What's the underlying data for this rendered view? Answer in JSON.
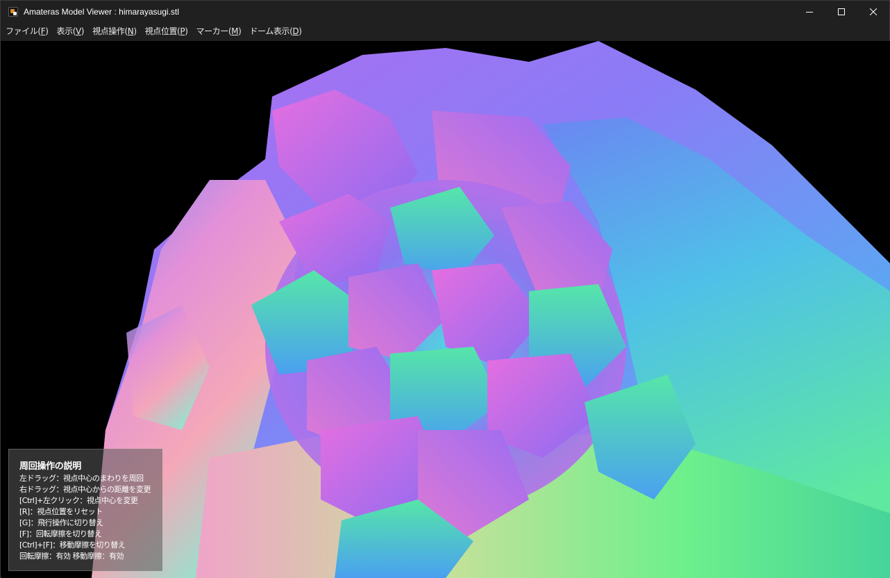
{
  "window": {
    "title": "Amateras Model Viewer : himarayasugi.stl"
  },
  "menu": [
    {
      "label": "ファイル(",
      "key": "F",
      "suffix": ")"
    },
    {
      "label": "表示(",
      "key": "V",
      "suffix": ")"
    },
    {
      "label": "視点操作(",
      "key": "N",
      "suffix": ")"
    },
    {
      "label": "視点位置(",
      "key": "P",
      "suffix": ")"
    },
    {
      "label": "マーカー(",
      "key": "M",
      "suffix": ")"
    },
    {
      "label": "ドーム表示(",
      "key": "D",
      "suffix": ")"
    }
  ],
  "help": {
    "title": "周回操作の説明",
    "lines": [
      "左ドラッグ：視点中心のまわりを周回",
      "右ドラッグ：視点中心からの距離を変更",
      "[Ctrl]+左クリック：視点中心を変更",
      "[R]：視点位置をリセット",
      "[G]：飛行操作に切り替え",
      "[F]：回転摩擦を切り替え",
      "[Ctrl]+[F]：移動摩擦を切り替え",
      "回転摩擦：有効 移動摩擦：有効"
    ]
  },
  "colors": {
    "chrome": "#202020",
    "viewport_bg": "#000000",
    "text": "#ffffff"
  },
  "icons": {
    "app": "app-icon",
    "minimize": "minimize-icon",
    "maximize": "maximize-icon",
    "close": "close-icon"
  }
}
